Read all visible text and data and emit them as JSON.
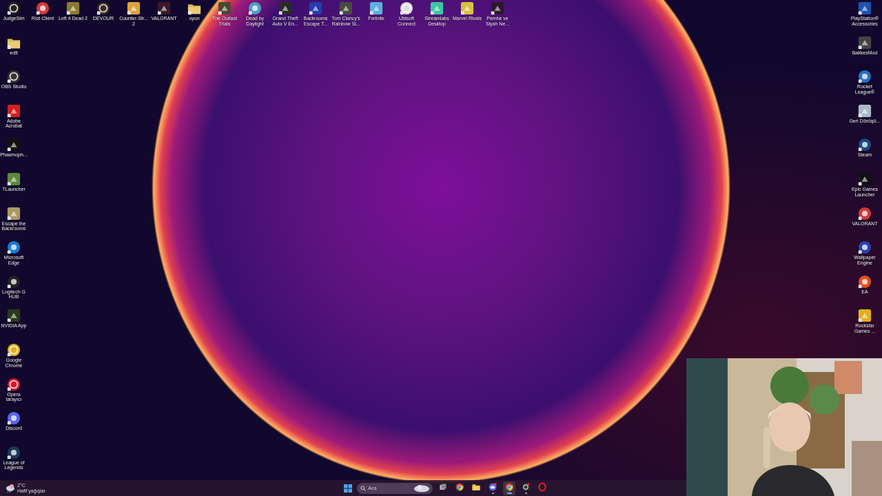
{
  "desktop": {
    "top_row": [
      {
        "label": "JudgeSim"
      },
      {
        "label": "Riot Client"
      },
      {
        "label": "Left 4 Dead 2"
      },
      {
        "label": "DEVOUR"
      },
      {
        "label": "Counter-Str... 2"
      },
      {
        "label": "VALORANT"
      },
      {
        "label": "oyun"
      },
      {
        "label": "The Outlast Trials"
      },
      {
        "label": "Dead by Daylight"
      },
      {
        "label": "Grand Theft Auto V En..."
      },
      {
        "label": "Backrooms Escape T..."
      },
      {
        "label": "Tom Clancy's Rainbow Si..."
      },
      {
        "label": "Fortnite"
      },
      {
        "label": "Ubisoft Connect"
      },
      {
        "label": "Streamlabs Desktop"
      },
      {
        "label": "Marvel Rivals"
      },
      {
        "label": "Pembe ve Siyah Ne..."
      }
    ],
    "left_column": [
      {
        "label": "edit"
      },
      {
        "label": "OBS Studio"
      },
      {
        "label": "Adobe Acrobat"
      },
      {
        "label": "Phasmoph..."
      },
      {
        "label": "TLauncher"
      },
      {
        "label": "Escape the Backrooms"
      },
      {
        "label": "Microsoft Edge"
      },
      {
        "label": "Logitech G HUB"
      },
      {
        "label": "NVIDIA App"
      },
      {
        "label": "Google Chrome"
      },
      {
        "label": "Opera tarayıcı"
      },
      {
        "label": "Discord"
      },
      {
        "label": "League of Legends"
      }
    ],
    "right_column": [
      {
        "label": "PlayStation® Accessories"
      },
      {
        "label": "BakkesMod"
      },
      {
        "label": "Rocket League®"
      },
      {
        "label": "Geri Dönüşü..."
      },
      {
        "label": "Steam"
      },
      {
        "label": "Epic Games Launcher"
      },
      {
        "label": "VALORANT"
      },
      {
        "label": "Wallpaper Engine"
      },
      {
        "label": "EA"
      },
      {
        "label": "Rockstar Games ..."
      }
    ]
  },
  "taskbar": {
    "weather": {
      "temperature": "2°C",
      "condition": "Hafif yağışlar"
    },
    "search": {
      "placeholder": "Ara"
    },
    "apps": [
      {
        "running": false,
        "selected": false
      },
      {
        "running": false,
        "selected": false
      },
      {
        "running": false,
        "selected": false
      },
      {
        "running": true,
        "selected": false
      },
      {
        "running": true,
        "selected": true
      },
      {
        "running": true,
        "selected": false
      },
      {
        "running": false,
        "selected": false
      }
    ]
  }
}
